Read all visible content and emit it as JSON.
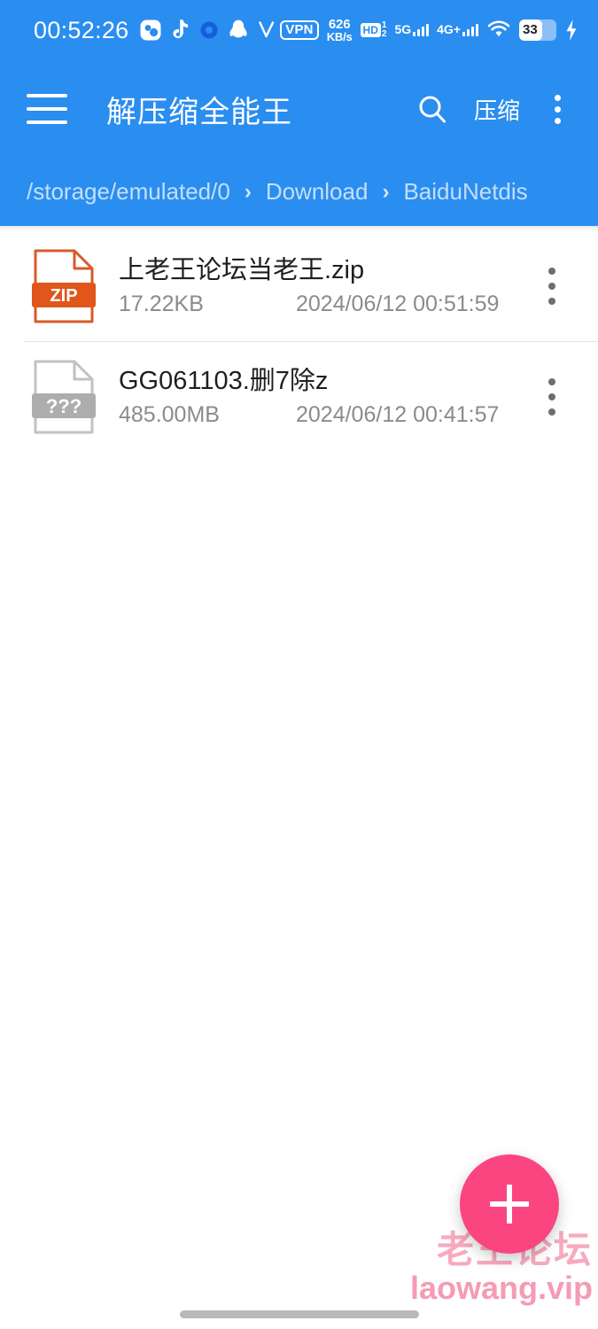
{
  "status_bar": {
    "clock": "00:52:26",
    "left_icons": [
      "photo-gallery-icon",
      "tiktok-icon",
      "blue-dot-icon",
      "qq-penguin-icon",
      "v-check-icon"
    ],
    "vpn_label": "VPN",
    "net_speed_value": "626",
    "net_speed_unit": "KB/s",
    "hd_label": "HD",
    "hd_numerator": "1",
    "hd_denominator": "2",
    "sim1_network": "5G",
    "sim2_network": "4G+",
    "wifi_icon": "wifi-icon",
    "battery_percent": "33",
    "charging_icon": "lightning-bolt-icon"
  },
  "appbar": {
    "menu_icon": "hamburger-menu-icon",
    "title": "解压缩全能王",
    "search_icon": "search-icon",
    "compress_label": "压缩",
    "overflow_icon": "overflow-menu-icon"
  },
  "breadcrumb": {
    "separator": "›",
    "items": [
      {
        "label": "/storage/emulated/0"
      },
      {
        "label": "Download"
      },
      {
        "label": "BaiduNetdis"
      }
    ]
  },
  "file_list": {
    "rows": [
      {
        "name": "上老王论坛当老王.zip",
        "size": "17.22KB",
        "date": "2024/06/12 00:51:59",
        "icon": "zip-file-icon",
        "icon_label": "ZIP",
        "icon_color": "#E0561B",
        "more_icon": "row-overflow-icon"
      },
      {
        "name": "GG061103.删7除z",
        "size": "485.00MB",
        "date": "2024/06/12 00:41:57",
        "icon": "unknown-file-icon",
        "icon_label": "???",
        "icon_color": "#ADADAD",
        "more_icon": "row-overflow-icon"
      }
    ]
  },
  "fab": {
    "icon": "plus-icon",
    "color": "#FB4581"
  },
  "watermark": {
    "line1": "老王论坛",
    "line2": "laowang.vip"
  },
  "theme": {
    "primary": "#2A8DF0",
    "accent": "#FB4581",
    "background": "#FFFFFF",
    "text_primary": "#1F1F1F",
    "text_secondary": "#8B8B8B"
  }
}
